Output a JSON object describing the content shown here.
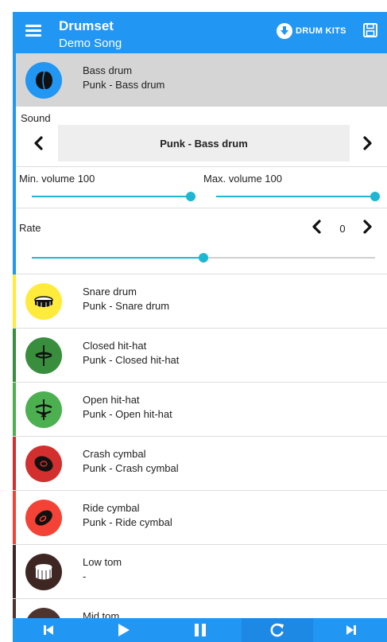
{
  "header": {
    "title": "Drumset",
    "subtitle": "Demo Song",
    "drum_kits_label": "DRUM KITS",
    "icons": [
      "menu-icon",
      "download-circle-icon",
      "save-icon"
    ]
  },
  "selected_drum": {
    "name": "Bass drum",
    "kit": "Punk - Bass drum",
    "color": "#2196f3",
    "sound_label": "Sound",
    "sound_value": "Punk - Bass drum",
    "min_volume_label": "Min. volume 100",
    "max_volume_label": "Max. volume 100",
    "min_volume": 100,
    "max_volume": 100,
    "rate_label": "Rate",
    "rate_value": "0",
    "rate_slider_fraction": 0.5
  },
  "drums": [
    {
      "name": "Snare drum",
      "kit": "Punk - Snare drum",
      "color": "#ffeb3b",
      "icon": "snare-drum-icon"
    },
    {
      "name": "Closed hit-hat",
      "kit": "Punk - Closed hit-hat",
      "color": "#388e3c",
      "icon": "closed-hihat-icon"
    },
    {
      "name": "Open hit-hat",
      "kit": "Punk - Open hit-hat",
      "color": "#4caf50",
      "icon": "open-hihat-icon"
    },
    {
      "name": "Crash cymbal",
      "kit": "Punk - Crash cymbal",
      "color": "#d32f2f",
      "icon": "crash-cymbal-icon"
    },
    {
      "name": "Ride cymbal",
      "kit": "Punk - Ride cymbal",
      "color": "#f44336",
      "icon": "ride-cymbal-icon"
    },
    {
      "name": "Low tom",
      "kit": "-",
      "color": "#3e2723",
      "icon": "tom-drum-icon"
    },
    {
      "name": "Mid tom",
      "kit": "",
      "color": "#4e342e",
      "icon": "tom-drum-icon"
    }
  ],
  "transport": {
    "active": "repeat",
    "icons": [
      "skip-previous-icon",
      "play-icon",
      "pause-icon",
      "repeat-icon",
      "skip-next-icon"
    ]
  }
}
